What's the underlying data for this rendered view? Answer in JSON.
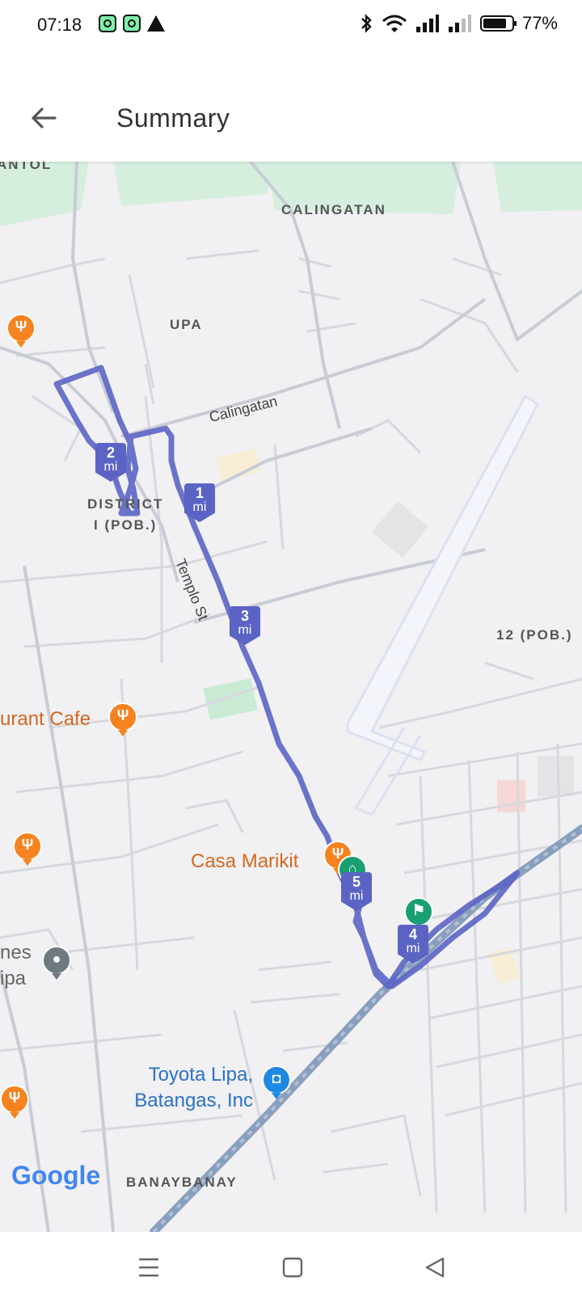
{
  "status_bar": {
    "time": "07:18",
    "left_icons": [
      "app-icon",
      "app-icon",
      "warning-icon"
    ],
    "right_icons": [
      "bluetooth-icon",
      "wifi-icon",
      "signal-icon",
      "signal-icon",
      "battery-icon"
    ],
    "battery": "77%"
  },
  "toolbar": {
    "back_icon": "arrow-left-icon",
    "title": "Summary"
  },
  "map": {
    "area_labels": [
      "ANTOL",
      "CALINGATAN",
      "UPA",
      "DISTRICT",
      "I (POB.)",
      "12 (POB.)",
      "BANAYBANAY"
    ],
    "road_labels": [
      "Calingatan",
      "Templo St"
    ],
    "places": {
      "cafe": "urant Cafe",
      "casa": "Casa Marikit",
      "toyota_line1": "Toyota Lipa,",
      "toyota_line2": "Batangas, Inc",
      "homes_line1": "nes",
      "homes_line2": "ipa"
    },
    "mile_markers": [
      {
        "num": "1",
        "unit": "mi"
      },
      {
        "num": "2",
        "unit": "mi"
      },
      {
        "num": "3",
        "unit": "mi"
      },
      {
        "num": "4",
        "unit": "mi"
      },
      {
        "num": "5",
        "unit": "mi"
      }
    ],
    "route_color": "#5b64c4",
    "attribution": "Google"
  },
  "nav_bar": {
    "buttons": [
      "menu-icon",
      "home-icon",
      "back-triangle-icon"
    ]
  }
}
